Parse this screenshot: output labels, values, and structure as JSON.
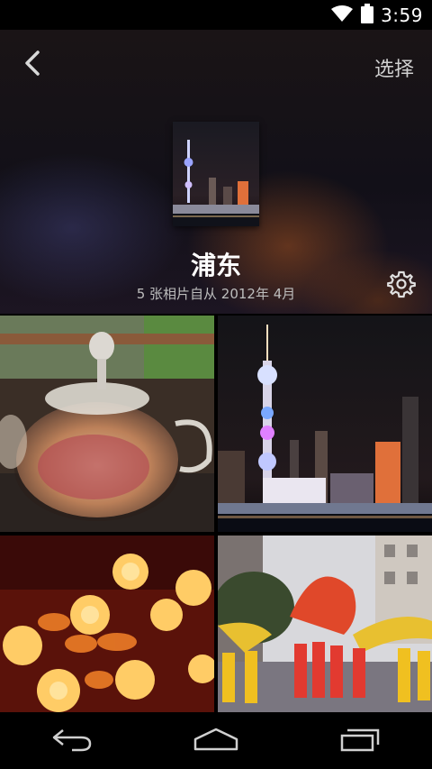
{
  "status": {
    "time": "3:59",
    "wifi_icon": "wifi-icon",
    "battery_icon": "battery-icon"
  },
  "header": {
    "back_icon": "chevron-left-icon",
    "select_label": "选择",
    "album_title": "浦东",
    "album_subtitle": "5 张相片自从 2012年 4月",
    "settings_icon": "gear-icon"
  },
  "photos": [
    {
      "name": "teapot-photo"
    },
    {
      "name": "oriental-pearl-tower-photo"
    },
    {
      "name": "lanterns-photo"
    },
    {
      "name": "dragon-dance-photo"
    }
  ],
  "nav": {
    "back_icon": "back-arrow-icon",
    "home_icon": "home-icon",
    "recents_icon": "recent-apps-icon"
  }
}
